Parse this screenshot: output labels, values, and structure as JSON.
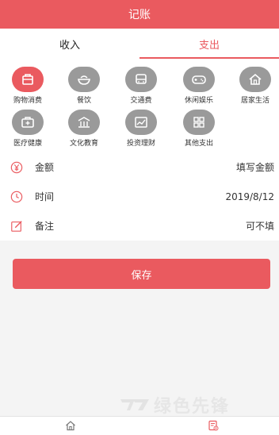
{
  "header": {
    "title": "记账"
  },
  "tabs": {
    "income": "收入",
    "expense": "支出",
    "active": "expense"
  },
  "categories": [
    {
      "label": "购物消费",
      "icon": "shopping-bag-icon",
      "active": true
    },
    {
      "label": "餐饮",
      "icon": "food-bowl-icon",
      "active": false
    },
    {
      "label": "交通费",
      "icon": "bus-icon",
      "active": false
    },
    {
      "label": "休闲娱乐",
      "icon": "gamepad-icon",
      "active": false
    },
    {
      "label": "居家生活",
      "icon": "home-icon",
      "active": false
    },
    {
      "label": "医疗健康",
      "icon": "medical-kit-icon",
      "active": false
    },
    {
      "label": "文化教育",
      "icon": "building-icon",
      "active": false
    },
    {
      "label": "投资理财",
      "icon": "chart-icon",
      "active": false
    },
    {
      "label": "其他支出",
      "icon": "grid-icon",
      "active": false
    }
  ],
  "form": {
    "amount": {
      "label": "金额",
      "value": "填写金额",
      "icon": "yen-icon"
    },
    "time": {
      "label": "时间",
      "value": "2019/8/12",
      "icon": "clock-icon"
    },
    "note": {
      "label": "备注",
      "value": "可不填",
      "icon": "edit-icon"
    }
  },
  "save_label": "保存",
  "watermark": "绿色先锋",
  "bottom_nav": [
    {
      "name": "home",
      "icon": "home-icon",
      "active": false
    },
    {
      "name": "bill",
      "icon": "bill-icon",
      "active": true
    }
  ],
  "colors": {
    "accent": "#ea5a5f",
    "icon_gray": "#9a9a9a",
    "background": "#f4f4f4"
  }
}
